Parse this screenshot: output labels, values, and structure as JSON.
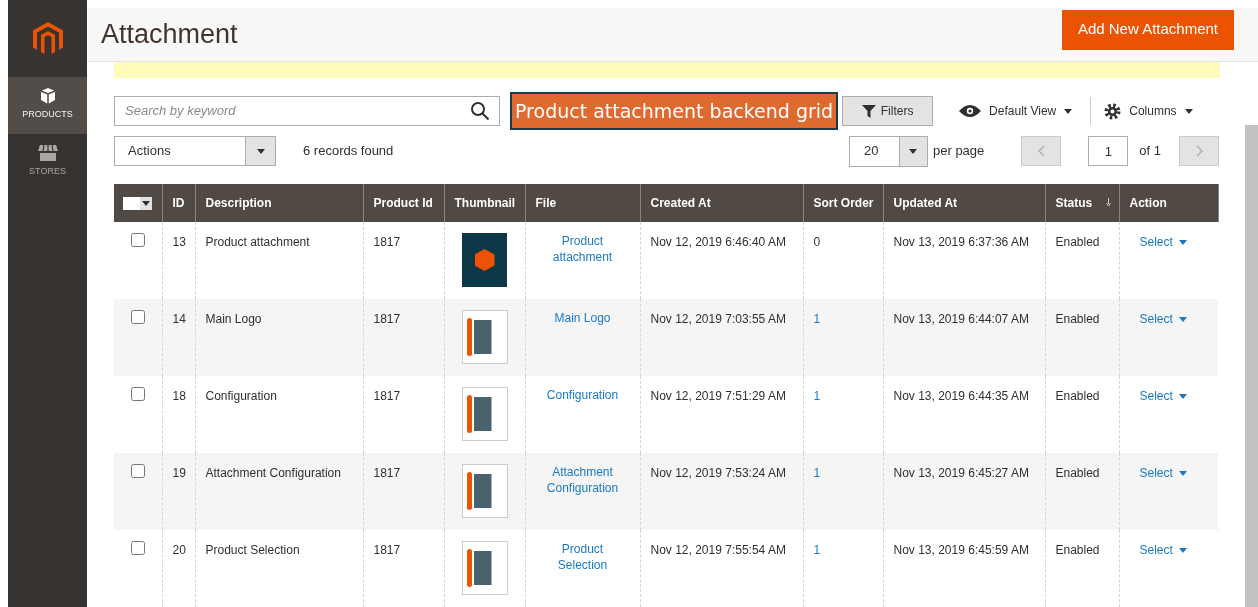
{
  "sidebar": {
    "items": [
      {
        "label": "PRODUCTS",
        "kind": "box",
        "selected": true
      },
      {
        "label": "STORES",
        "kind": "store",
        "selected": false
      }
    ]
  },
  "header": {
    "title": "Attachment",
    "primary_button": "Add New Attachment"
  },
  "toolbar": {
    "search": {
      "placeholder": "Search by keyword"
    },
    "callout": "Product attachment backend grid",
    "filters_button": "Filters",
    "view_menu": "Default View",
    "columns_menu": "Columns"
  },
  "grid_controls": {
    "actions": "Actions",
    "records": "6 records found",
    "page_size": "20",
    "per_page_label": "per page",
    "page": "1",
    "of_label": "of 1"
  },
  "table": {
    "columns": [
      {
        "label": "ID",
        "sorted": false
      },
      {
        "label": "Description",
        "sorted": false
      },
      {
        "label": "Product Id",
        "sorted": false
      },
      {
        "label": "Thumbnail",
        "sorted": false
      },
      {
        "label": "File",
        "sorted": false
      },
      {
        "label": "Created At",
        "sorted": false
      },
      {
        "label": "Sort Order",
        "sorted": false
      },
      {
        "label": "Updated At",
        "sorted": false
      },
      {
        "label": "Status",
        "sorted": true
      },
      {
        "label": "Action",
        "sorted": false
      }
    ],
    "rows": [
      {
        "checked": false,
        "id": "13",
        "description": "Product attachment",
        "product_id": "1817",
        "thumbnail": {
          "kind": "poster"
        },
        "file": "Product attachment",
        "created_at": "Nov 12, 2019 6:46:40 AM",
        "sort_order": "0",
        "sort_order_link": false,
        "updated_at": "Nov 13, 2019 6:37:36 AM",
        "status": "Enabled",
        "action": "Select"
      },
      {
        "checked": false,
        "id": "14",
        "description": "Main Logo",
        "product_id": "1817",
        "thumbnail": {
          "kind": "logo"
        },
        "file": "Main Logo",
        "created_at": "Nov 12, 2019 7:03:55 AM",
        "sort_order": "1",
        "sort_order_link": true,
        "updated_at": "Nov 13, 2019 6:44:07 AM",
        "status": "Enabled",
        "action": "Select"
      },
      {
        "checked": false,
        "id": "18",
        "description": "Configuration",
        "product_id": "1817",
        "thumbnail": {
          "kind": "logo"
        },
        "file": "Configuration",
        "created_at": "Nov 12, 2019 7:51:29 AM",
        "sort_order": "1",
        "sort_order_link": true,
        "updated_at": "Nov 13, 2019 6:44:35 AM",
        "status": "Enabled",
        "action": "Select"
      },
      {
        "checked": false,
        "id": "19",
        "description": "Attachment Configuration",
        "product_id": "1817",
        "thumbnail": {
          "kind": "logo"
        },
        "file": "Attachment Configuration",
        "created_at": "Nov 12, 2019 7:53:24 AM",
        "sort_order": "1",
        "sort_order_link": true,
        "updated_at": "Nov 13, 2019 6:45:27 AM",
        "status": "Enabled",
        "action": "Select"
      },
      {
        "checked": false,
        "id": "20",
        "description": "Product Selection",
        "product_id": "1817",
        "thumbnail": {
          "kind": "logo"
        },
        "file": "Product Selection",
        "created_at": "Nov 12, 2019 7:55:54 AM",
        "sort_order": "1",
        "sort_order_link": true,
        "updated_at": "Nov 13, 2019 6:45:59 AM",
        "status": "Enabled",
        "action": "Select"
      }
    ]
  }
}
